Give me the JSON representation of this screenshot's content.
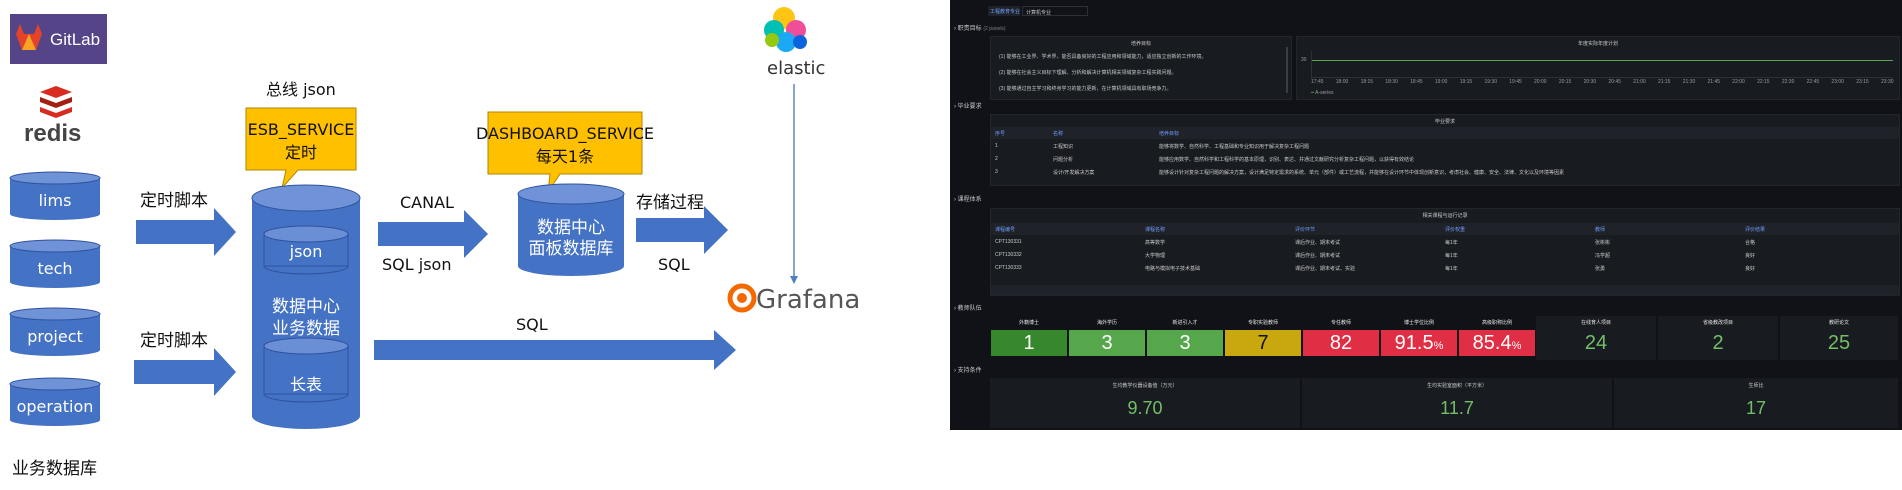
{
  "left": {
    "logos": {
      "gitlab": "GitLab",
      "redis": "redis",
      "elastic": "elastic",
      "grafana": "Grafana"
    },
    "databases": [
      "lims",
      "tech",
      "project",
      "operation"
    ],
    "business_db_label": "业务数据库",
    "bus_json_label": "总线 json",
    "esb_callout": {
      "line1": "ESB_SERVICE",
      "line2": "定时"
    },
    "dashboard_callout": {
      "line1": "DASHBOARD_SERVICE",
      "line2": "每天1条"
    },
    "arrow_labels": {
      "script1": "定时脚本",
      "script2": "定时脚本",
      "canal": "CANAL",
      "sql_json": "SQL  json",
      "stored_proc": "存储过程",
      "sql1": "SQL",
      "sql2": "SQL"
    },
    "center_db": {
      "inner_top": "json",
      "line1": "数据中心",
      "line2": "业务数据",
      "inner_bottom": "长表"
    },
    "panel_db": {
      "line1": "数据中心",
      "line2": "面板数据库"
    },
    "colors": {
      "blue": "#4472c4",
      "arrow": "#4472c4",
      "callout": "#ffc000"
    }
  },
  "dashboard": {
    "filter": {
      "label": "工程教育专业",
      "value": "计算机专业"
    },
    "sections": [
      "职责目标",
      "毕业要求",
      "课程体系",
      "教师队伍",
      "支持条件"
    ],
    "goals_header": "(2 panels)",
    "goals_panel_title": "培养目标",
    "goals": [
      "(1) 能够在工业界、学术界，能否具备良好的工程应用和领域能力，适应独立创新的工作环境。",
      "(2) 能够在社会主义目标下理解、分析和解决计算机相关领域复杂工程实践问题。",
      "(3) 能够通过自主学习和终身学习的能力更新，在计算机领域具有职场竞争力。"
    ],
    "timeseries_title": "年度实际年度计划",
    "timeseries_ytick": "30",
    "timeseries_times": [
      "17:45",
      "18:00",
      "18:15",
      "18:30",
      "18:45",
      "19:00",
      "19:15",
      "19:30",
      "19:45",
      "20:00",
      "20:15",
      "20:30",
      "20:45",
      "21:00",
      "21:15",
      "21:30",
      "21:45",
      "22:00",
      "22:15",
      "22:30",
      "22:45",
      "23:00",
      "23:15",
      "23:30"
    ],
    "timeseries_legend": "A-series",
    "grad_table": {
      "title": "毕业要求",
      "headers": [
        "序号",
        "名称",
        "培养目标"
      ],
      "rows": [
        [
          "1",
          "工程知识",
          "能够将数学、自然科学、工程基础和专业知识用于解决复杂工程问题"
        ],
        [
          "2",
          "问题分析",
          "能够应用数学、自然科学和工程科学的基本原理，识别、表达、并通过文献研究分析复杂工程问题，以获得有效结论"
        ],
        [
          "3",
          "设计/开发解决方案",
          "能够设计针对复杂工程问题的解决方案，设计满足特定需求的系统、单元（部件）或工艺流程，并能够在设计环节中体现创新意识，考虑社会、健康、安全、法律、文化以及环境等因素"
        ]
      ]
    },
    "course_table": {
      "title": "相关课程与运行记录",
      "headers": [
        "课程编号",
        "课程名称",
        "评价环节",
        "评价权重",
        "教师",
        "评价结果"
      ],
      "rows": [
        [
          "CPT130331",
          "高等数学",
          "课后作业、期末考试",
          "每1年",
          "张彬彬",
          "合格"
        ],
        [
          "CPT130332",
          "大学物理",
          "课后作业、期末考试",
          "每1年",
          "冯学超",
          "良好"
        ],
        [
          "CPT130333",
          "电路与模拟电子技术基础",
          "课后作业、期末考试、实验",
          "每1年",
          "张勇",
          "良好"
        ]
      ]
    },
    "teachers": [
      {
        "label": "外籍博士",
        "value": "1",
        "bg": "#37872d",
        "fg": "#ffffff"
      },
      {
        "label": "海外学历",
        "value": "3",
        "bg": "#56a64b",
        "fg": "#ffffff"
      },
      {
        "label": "新进引入才",
        "value": "3",
        "bg": "#56a64b",
        "fg": "#ffffff"
      },
      {
        "label": "专职实验教师",
        "value": "7",
        "bg": "#c8a80e",
        "fg": "#111111"
      },
      {
        "label": "专任教师",
        "value": "82",
        "bg": "#e02f44",
        "fg": "#ffffff"
      },
      {
        "label": "博士学位比例",
        "value": "91.5",
        "unit": "%",
        "bg": "#e02f44",
        "fg": "#ffffff"
      },
      {
        "label": "高级职称比例",
        "value": "85.4",
        "unit": "%",
        "bg": "#e02f44",
        "fg": "#ffffff"
      },
      {
        "label": "在线育人项目",
        "value": "24",
        "bg": "#181b1f",
        "fg": "#73bf69"
      },
      {
        "label": "省级教改项目",
        "value": "2",
        "bg": "#181b1f",
        "fg": "#73bf69"
      },
      {
        "label": "教研论文",
        "value": "25",
        "bg": "#181b1f",
        "fg": "#73bf69"
      }
    ],
    "support": [
      {
        "label": "生均教学仪器设备值（万元）",
        "value": "9.70"
      },
      {
        "label": "生均实验室面积（平方米）",
        "value": "11.7"
      },
      {
        "label": "生师比",
        "value": "17"
      }
    ]
  }
}
